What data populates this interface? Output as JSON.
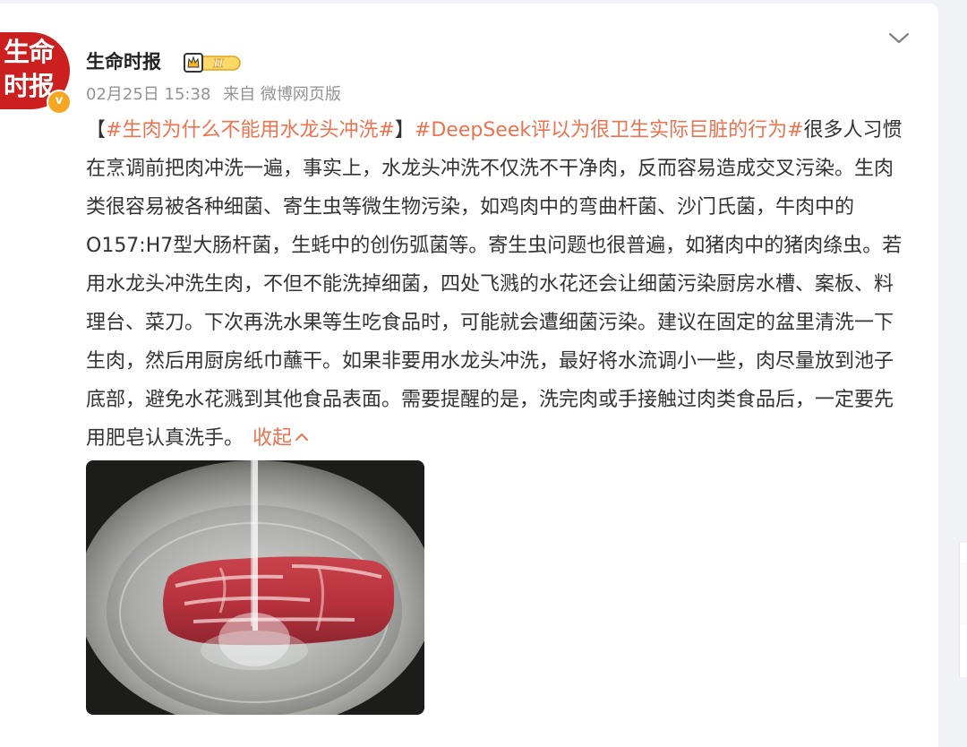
{
  "post": {
    "author": {
      "name": "生命时报",
      "avatar_text_1": "生命",
      "avatar_text_2": "时报",
      "verified_mark": "v",
      "level": "II"
    },
    "meta": {
      "date": "02月25日 15:38",
      "source": "来自 微博网页版"
    },
    "bracket_open": "【",
    "tag1": "#生肉为什么不能用水龙头冲洗#",
    "bracket_close": "】",
    "tag2": "#DeepSeek评以为很卫生实际巨脏的行为#",
    "body": "很多人习惯在烹调前把肉冲洗一遍，事实上，水龙头冲洗不仅洗不干净肉，反而容易造成交叉污染。生肉类很容易被各种细菌、寄生虫等微生物污染，如鸡肉中的弯曲杆菌、沙门氏菌，牛肉中的 O157:H7型大肠杆菌，生蚝中的创伤弧菌等。寄生虫问题也很普遍，如猪肉中的猪肉绦虫。若用水龙头冲洗生肉，不但不能洗掉细菌，四处飞溅的水花还会让细菌污染厨房水槽、案板、料理台、菜刀。下次再洗水果等生吃食品时，可能就会遭细菌污染。建议在固定的盆里清洗一下生肉，然后用厨房纸巾蘸干。如果非要用水龙头冲洗，最好将水流调小一些，肉尽量放到池子底部，避免水花溅到其他食品表面。需要提醒的是，洗完肉或手接触过肉类食品后，一定要先用肥皂认真洗手。",
    "collapse_label": "收起"
  },
  "colors": {
    "accent": "#eb7350",
    "avatar_red": "#cc1f1f",
    "meta_gray": "#939393",
    "text": "#333333"
  },
  "icons": {
    "menu": "chevron-down-icon",
    "collapse": "chevron-up-icon",
    "level": "crown-level-icon"
  }
}
